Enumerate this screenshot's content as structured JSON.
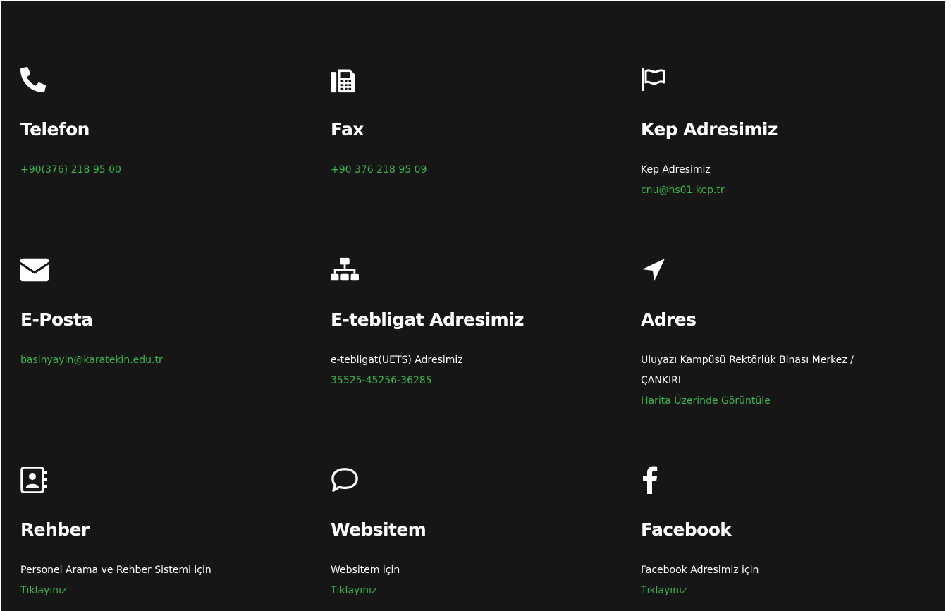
{
  "colors": {
    "background": "#161616",
    "text": "#ffffff",
    "link": "#3ab54a"
  },
  "cards": {
    "telefon": {
      "icon": "phone-icon",
      "title": "Telefon",
      "link": "+90(376) 218 95 00"
    },
    "fax": {
      "icon": "fax-icon",
      "title": "Fax",
      "link": "+90 376 218 95 09"
    },
    "kep": {
      "icon": "flag-icon",
      "title": "Kep Adresimiz",
      "label": "Kep Adresimiz",
      "link": "cnu@hs01.kep.tr"
    },
    "eposta": {
      "icon": "envelope-icon",
      "title": "E-Posta",
      "link": "basinyayin@karatekin.edu.tr"
    },
    "etebligat": {
      "icon": "sitemap-icon",
      "title": "E-tebligat Adresimiz",
      "label": "e-tebligat(UETS) Adresimiz",
      "link": "35525-45256-36285"
    },
    "adres": {
      "icon": "location-arrow-icon",
      "title": "Adres",
      "label": "Uluyazı Kampüsü Rektörlük Binası Merkez / ÇANKIRI",
      "link": "Harita Üzerinde Görüntüle"
    },
    "rehber": {
      "icon": "address-book-icon",
      "title": "Rehber",
      "label": "Personel Arama ve Rehber Sistemi için",
      "link": "Tıklayınız"
    },
    "website": {
      "icon": "comment-icon",
      "title": "Websitem",
      "label": "Websitem için",
      "link": "Tıklayınız"
    },
    "facebook": {
      "icon": "facebook-icon",
      "title": "Facebook",
      "label": "Facebook Adresimiz için",
      "link": "Tıklayınız"
    }
  }
}
